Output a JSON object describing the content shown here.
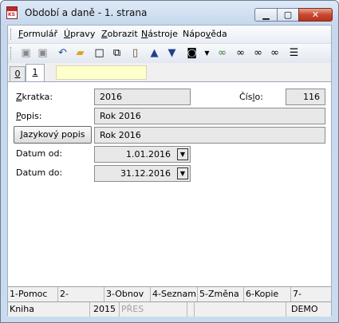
{
  "window": {
    "title": "Období a daně - 1. strana"
  },
  "menu": [
    {
      "pre": "",
      "u": "F",
      "post": "ormulář"
    },
    {
      "pre": "",
      "u": "Ú",
      "post": "pravy"
    },
    {
      "pre": "",
      "u": "Z",
      "post": "obrazit"
    },
    {
      "pre": "",
      "u": "N",
      "post": "ástroje"
    },
    {
      "pre": "Nápo",
      "u": "v",
      "post": "ěda"
    }
  ],
  "toolbar_icons": [
    "save-icon",
    "save-as-icon",
    "undo-icon",
    "open-folder-icon",
    "new-document-icon",
    "copy-icon",
    "book-icon",
    "arrow-up-icon",
    "arrow-down-icon",
    "camera-icon",
    "dropdown-arrow-icon",
    "filter-binoculars-icon",
    "binoculars-icon",
    "find-next-icon",
    "find-prev-icon",
    "menu-lines-icon"
  ],
  "tabs": [
    {
      "label": "0"
    },
    {
      "label": "1"
    }
  ],
  "form": {
    "zkratka": {
      "label_u": "Z",
      "label_rest": "kratka:",
      "value": "2016"
    },
    "cislo": {
      "label_pre": "Čís",
      "label_u": "l",
      "label_rest": "o:",
      "value": "116"
    },
    "popis": {
      "label_u": "P",
      "label_rest": "opis:",
      "value": "Rok 2016"
    },
    "jazykovy_button": {
      "label_u": "J",
      "label_rest": "azykový popis",
      "value": "Rok 2016"
    },
    "datum_od": {
      "label": "Datum od:",
      "value": "1.01.2016"
    },
    "datum_do": {
      "label": "Datum do:",
      "value": "31.12.2016"
    }
  },
  "function_keys": [
    "1-Pomoc",
    "2-",
    "3-Obnov",
    "4-Seznam",
    "5-Změna",
    "6-Kopie",
    "7-"
  ],
  "status": {
    "module": "Kniha",
    "year": "2015",
    "mode": "PŘES",
    "empty1": "",
    "empty2": "",
    "db": "DEMO"
  },
  "colors": {
    "title_bg": "#c9dbef",
    "close_red": "#c9482f",
    "field_bg": "#e8e8e8",
    "tab_yellow": "#ffffcc"
  }
}
